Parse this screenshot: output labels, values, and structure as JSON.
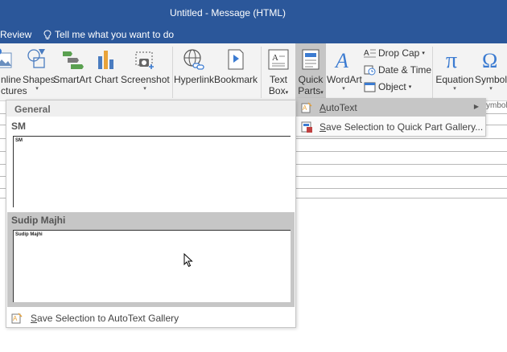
{
  "window": {
    "title": "Untitled - Message (HTML)"
  },
  "menubar": {
    "review_tab": "Review",
    "tell_me": "Tell me what you want to do"
  },
  "ribbon": {
    "online_pictures": {
      "line1": "nline",
      "line2": "ctures"
    },
    "shapes": "Shapes",
    "smartart": "SmartArt",
    "chart": "Chart",
    "screenshot": "Screenshot",
    "hyperlink": "Hyperlink",
    "bookmark": "Bookmark",
    "text_box": {
      "line1": "Text",
      "line2": "Box"
    },
    "quick_parts": {
      "line1": "Quick",
      "line2": "Parts"
    },
    "wordart": "WordArt",
    "drop_cap": "Drop Cap",
    "date_time": "Date & Time",
    "object": "Object",
    "equation": "Equation",
    "symbol": "Symbol",
    "symbols_group": "ymbols",
    "caret": "▾",
    "accent_color": "#2b579a"
  },
  "quick_parts_menu": {
    "autotext": {
      "prefix": "A",
      "rest": "utoText"
    },
    "save_selection": {
      "prefix": "S",
      "rest": "ave Selection to Quick Part Gallery..."
    },
    "submenu_arrow": "▶"
  },
  "autotext_gallery": {
    "header": "General",
    "entries": [
      {
        "name": "SM",
        "preview": "SM",
        "selected": false
      },
      {
        "name": "Sudip Majhi",
        "preview": "Sudip Majhi",
        "selected": true
      }
    ],
    "footer": {
      "prefix": "S",
      "rest": "ave Selection to AutoText Gallery"
    }
  }
}
